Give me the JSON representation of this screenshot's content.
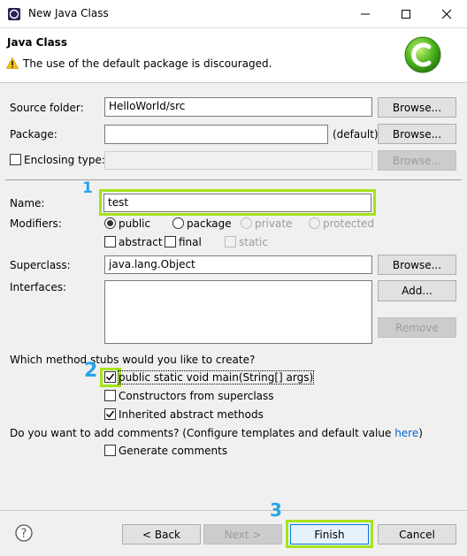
{
  "window": {
    "title": "New Java Class"
  },
  "header": {
    "title": "Java Class",
    "warning": "The use of the default package is discouraged."
  },
  "form": {
    "source_folder_label": "Source folder:",
    "source_folder_value": "HelloWorld/src",
    "package_label": "Package:",
    "package_value": "",
    "package_default": "(default)",
    "enclosing_label": "Enclosing type:",
    "browse_label": "Browse...",
    "name_label": "Name:",
    "name_value": "test",
    "modifiers_label": "Modifiers:",
    "modifiers": {
      "public": "public",
      "package": "package",
      "private": "private",
      "protected": "protected",
      "abstract": "abstract",
      "final": "final",
      "static": "static",
      "selected": "public"
    },
    "superclass_label": "Superclass:",
    "superclass_value": "java.lang.Object",
    "interfaces_label": "Interfaces:",
    "add_label": "Add...",
    "remove_label": "Remove",
    "stubs_question": "Which method stubs would you like to create?",
    "stubs": [
      {
        "label": "public static void main(String[] args)",
        "checked": true
      },
      {
        "label": "Constructors from superclass",
        "checked": false
      },
      {
        "label": "Inherited abstract methods",
        "checked": true
      }
    ],
    "comments_question": "Do you want to add comments? (Configure templates and default value ",
    "comments_link": "here",
    "comments_question_end": ")",
    "generate_comments_label": "Generate comments"
  },
  "footer": {
    "back_label": "< Back",
    "next_label": "Next >",
    "finish_label": "Finish",
    "cancel_label": "Cancel"
  },
  "annotations": {
    "step1": "1",
    "step2": "2",
    "step3": "3"
  },
  "colors": {
    "highlight": "#a6e31a",
    "annotation": "#29a3e6"
  }
}
